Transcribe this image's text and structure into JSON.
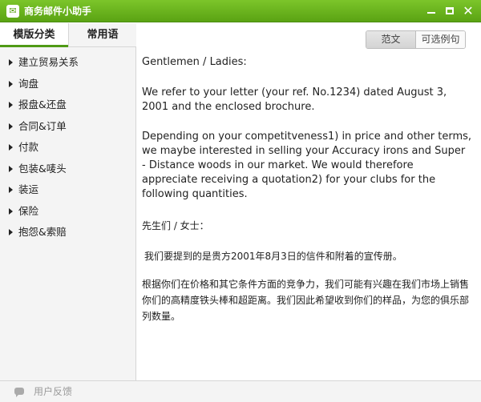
{
  "app": {
    "title": "商务邮件小助手",
    "icon": "mail-icon"
  },
  "window_controls": [
    "minimize-icon",
    "maximize-icon",
    "close-icon"
  ],
  "tabs": [
    {
      "label": "模版分类",
      "active": true
    },
    {
      "label": "常用语",
      "active": false
    }
  ],
  "categories": [
    "建立贸易关系",
    "询盘",
    "报盘&还盘",
    "合同&订单",
    "付款",
    "包装&唛头",
    "装运",
    "保险",
    "抱怨&索赔"
  ],
  "view_toggle": {
    "options": [
      "范文",
      "可选例句"
    ],
    "selected": "范文"
  },
  "letter": {
    "greeting_en": "Gentlemen / Ladies:",
    "para1_en": "We refer to your letter (your ref. No.1234) dated August 3, 2001 and the enclosed brochure.",
    "para2_en": "Depending on your competitveness1) in price and other terms, we maybe interested in selling your Accuracy irons and Super - Distance woods in our market. We would therefore appreciate receiving a quotation2) for your clubs for the following quantities.",
    "greeting_zh": "先生们 / 女士：",
    "para1_zh": "我们要提到的是贵方2001年8月3日的信件和附着的宣传册。",
    "para2_zh": "根据你们在价格和其它条件方面的竞争力，我们可能有兴趣在我们市场上销售你们的高精度铁头棒和超距离。我们因此希望收到你们的样品，为您的俱乐部列数量。"
  },
  "footer": {
    "feedback_label": "用户反馈",
    "icon": "chat-bubble-icon"
  },
  "colors": {
    "titlebar": "#6ab41f",
    "tab_underline": "#4f9a15",
    "sidebar_bg": "#f4f4f4"
  }
}
